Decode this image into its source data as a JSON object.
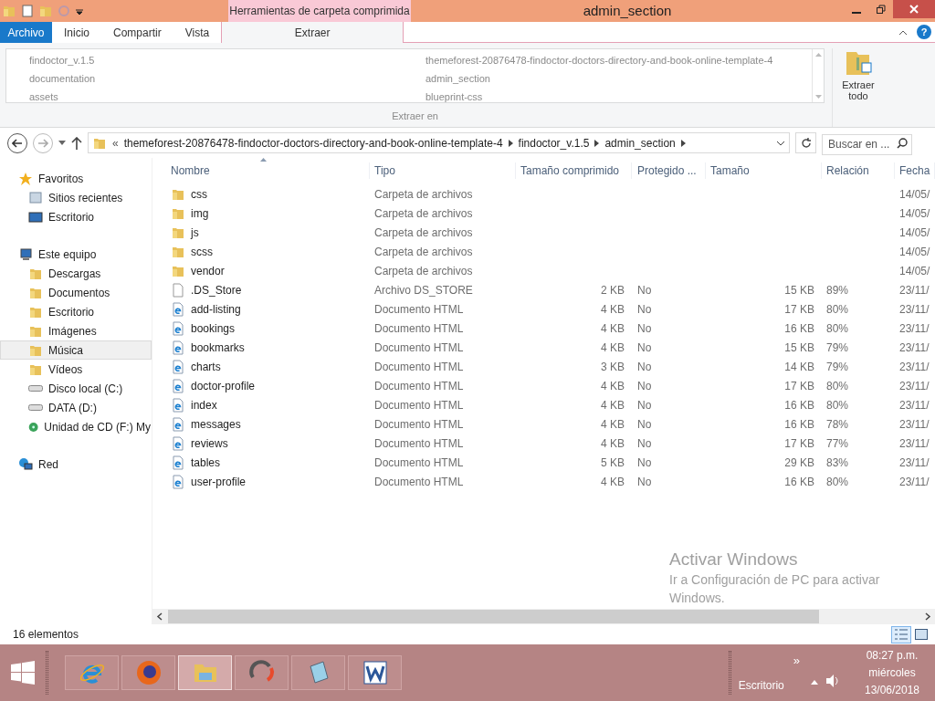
{
  "window": {
    "title": "admin_section",
    "context_tab": "Herramientas de carpeta comprimida"
  },
  "ribbon_tabs": [
    {
      "label": "Archivo",
      "kind": "file"
    },
    {
      "label": "Inicio",
      "kind": "tab",
      "selected": false
    },
    {
      "label": "Compartir",
      "kind": "tab",
      "selected": false
    },
    {
      "label": "Vista",
      "kind": "tab",
      "selected": false
    },
    {
      "label": "Extraer",
      "kind": "context",
      "selected": true
    }
  ],
  "extract_targets": {
    "column_1": [
      "findoctor_v.1.5",
      "documentation",
      "assets"
    ],
    "column_2": [
      "themeforest-20876478-findoctor-doctors-directory-and-book-online-template-4",
      "admin_section",
      "blueprint-css"
    ],
    "group_label": "Extraer en"
  },
  "extract_all_button": {
    "label_1": "Extraer",
    "label_2": "todo"
  },
  "address_bar": {
    "overflow": "«",
    "segments": [
      "themeforest-20876478-findoctor-doctors-directory-and-book-online-template-4",
      "findoctor_v.1.5",
      "admin_section"
    ]
  },
  "search": {
    "placeholder": "Buscar en ..."
  },
  "sidebar": {
    "items": [
      {
        "label": "Favoritos",
        "selected": false,
        "children": [
          {
            "label": "Sitios recientes",
            "selected": false
          },
          {
            "label": "Escritorio",
            "selected": false
          }
        ]
      },
      {
        "label": "Este equipo",
        "selected": false,
        "children": [
          {
            "label": "Descargas",
            "selected": false
          },
          {
            "label": "Documentos",
            "selected": false
          },
          {
            "label": "Escritorio",
            "selected": false
          },
          {
            "label": "Imágenes",
            "selected": false
          },
          {
            "label": "Música",
            "selected": true
          },
          {
            "label": "Vídeos",
            "selected": false
          },
          {
            "label": "Disco local (C:)",
            "selected": false
          },
          {
            "label": "DATA (D:)",
            "selected": false
          },
          {
            "label": "Unidad de CD (F:) My",
            "selected": false
          }
        ]
      },
      {
        "label": "Red",
        "selected": false
      }
    ]
  },
  "help_button": {
    "label": "?"
  },
  "table": {
    "columns": [
      "Nombre",
      "Tipo",
      "Tamaño comprimido",
      "Protegido ...",
      "Tamaño",
      "Relación",
      "Fecha"
    ],
    "rows": [
      {
        "kind": "folder",
        "name": "css",
        "type": "Carpeta de archivos",
        "compressed": "",
        "protected": "",
        "size": "",
        "ratio": "",
        "date": "14/05/"
      },
      {
        "kind": "folder",
        "name": "img",
        "type": "Carpeta de archivos",
        "compressed": "",
        "protected": "",
        "size": "",
        "ratio": "",
        "date": "14/05/"
      },
      {
        "kind": "folder",
        "name": "js",
        "type": "Carpeta de archivos",
        "compressed": "",
        "protected": "",
        "size": "",
        "ratio": "",
        "date": "14/05/"
      },
      {
        "kind": "folder",
        "name": "scss",
        "type": "Carpeta de archivos",
        "compressed": "",
        "protected": "",
        "size": "",
        "ratio": "",
        "date": "14/05/"
      },
      {
        "kind": "folder",
        "name": "vendor",
        "type": "Carpeta de archivos",
        "compressed": "",
        "protected": "",
        "size": "",
        "ratio": "",
        "date": "14/05/"
      },
      {
        "kind": "file",
        "name": ".DS_Store",
        "type": "Archivo DS_STORE",
        "compressed": "2 KB",
        "protected": "No",
        "size": "15 KB",
        "ratio": "89%",
        "date": "23/11/"
      },
      {
        "kind": "html",
        "name": "add-listing",
        "type": "Documento HTML",
        "compressed": "4 KB",
        "protected": "No",
        "size": "17 KB",
        "ratio": "80%",
        "date": "23/11/"
      },
      {
        "kind": "html",
        "name": "bookings",
        "type": "Documento HTML",
        "compressed": "4 KB",
        "protected": "No",
        "size": "16 KB",
        "ratio": "80%",
        "date": "23/11/"
      },
      {
        "kind": "html",
        "name": "bookmarks",
        "type": "Documento HTML",
        "compressed": "4 KB",
        "protected": "No",
        "size": "15 KB",
        "ratio": "79%",
        "date": "23/11/"
      },
      {
        "kind": "html",
        "name": "charts",
        "type": "Documento HTML",
        "compressed": "3 KB",
        "protected": "No",
        "size": "14 KB",
        "ratio": "79%",
        "date": "23/11/"
      },
      {
        "kind": "html",
        "name": "doctor-profile",
        "type": "Documento HTML",
        "compressed": "4 KB",
        "protected": "No",
        "size": "17 KB",
        "ratio": "80%",
        "date": "23/11/"
      },
      {
        "kind": "html",
        "name": "index",
        "type": "Documento HTML",
        "compressed": "4 KB",
        "protected": "No",
        "size": "16 KB",
        "ratio": "80%",
        "date": "23/11/"
      },
      {
        "kind": "html",
        "name": "messages",
        "type": "Documento HTML",
        "compressed": "4 KB",
        "protected": "No",
        "size": "16 KB",
        "ratio": "78%",
        "date": "23/11/"
      },
      {
        "kind": "html",
        "name": "reviews",
        "type": "Documento HTML",
        "compressed": "4 KB",
        "protected": "No",
        "size": "17 KB",
        "ratio": "77%",
        "date": "23/11/"
      },
      {
        "kind": "html",
        "name": "tables",
        "type": "Documento HTML",
        "compressed": "5 KB",
        "protected": "No",
        "size": "29 KB",
        "ratio": "83%",
        "date": "23/11/"
      },
      {
        "kind": "html",
        "name": "user-profile",
        "type": "Documento HTML",
        "compressed": "4 KB",
        "protected": "No",
        "size": "16 KB",
        "ratio": "80%",
        "date": "23/11/"
      }
    ]
  },
  "activation_notice": {
    "title": "Activar Windows",
    "text": "Ir a Configuración de PC para activar Windows."
  },
  "status_bar": {
    "count": "16 elementos"
  },
  "taskbar": {
    "apps": [
      {
        "kind": "ie",
        "active": false
      },
      {
        "kind": "firefox",
        "active": false
      },
      {
        "kind": "explorer",
        "active": true
      },
      {
        "kind": "sync",
        "active": false
      },
      {
        "kind": "notepad",
        "active": false
      },
      {
        "kind": "word",
        "active": false
      }
    ],
    "overflow": "»",
    "desktop_label": "Escritorio",
    "time": "08:27 p.m.",
    "day": "miércoles",
    "date": "13/06/2018"
  }
}
